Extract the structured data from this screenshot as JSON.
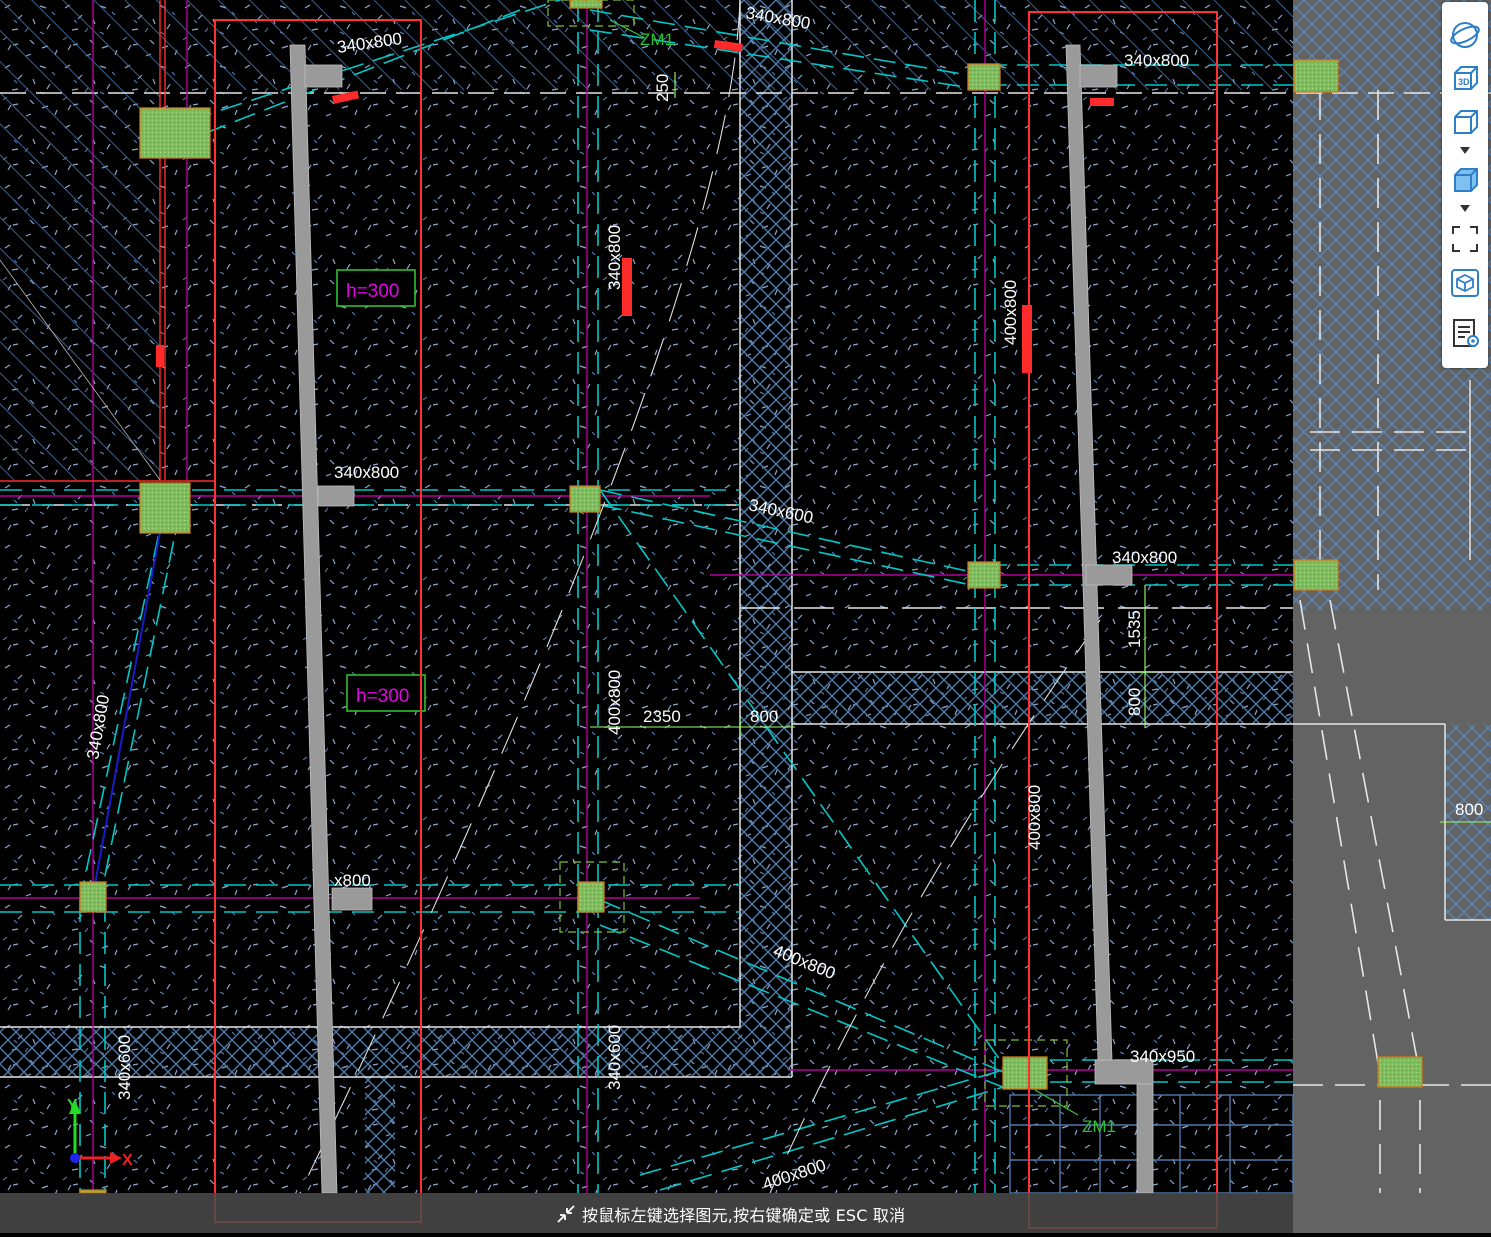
{
  "colors": {
    "background": "#000000",
    "cyan": "#00c8c8",
    "magenta": "#b4009a",
    "red": "#ff2a2a",
    "green_fill": "#7fbf5a",
    "hatch": "#4a78b0",
    "member": "#9a9a9a",
    "selection": "#ff3030",
    "toolbar_icon": "#2d7fc8"
  },
  "canvas": {
    "labels": {
      "beam_340x800_top_left": "340x800",
      "beam_340x800_top_right": "340x800",
      "beam_340x800_mid_left": "340x800",
      "beam_340x800_mid_right": "340x800",
      "beam_340x800_low_left": "x800",
      "beam_340x800_vertical_center": "340x800",
      "beam_340x800_top_center": "340x800",
      "beam_340x800_diag_left": "340x800",
      "beam_340x800_diag_center": "340x600",
      "beam_400x800_center_vertical": "400x800",
      "beam_400x800_right_vertical": "400x800",
      "beam_400x800_right_vertical_low": "400x800",
      "beam_400x800_diag": "400x800",
      "beam_400x800_bottom": "400x800",
      "beam_340x950": "340x950",
      "beam_340x600_left_bottom": "340x600",
      "beam_340x600_center_bottom": "340x600",
      "slab_h_300_a": "h=300",
      "slab_h_300_b": "h=300",
      "door_zm1_top": "ZM1",
      "door_zm1_bottom": "ZM1",
      "dim_250": "250",
      "dim_2350": "2350",
      "dim_800_a": "800",
      "dim_800_b": "800",
      "dim_800_c": "800",
      "dim_1535": "1535"
    },
    "axis": {
      "x": "X",
      "y": "Y"
    }
  },
  "toolbar": {
    "items": [
      {
        "icon": "orbit-icon"
      },
      {
        "icon": "3d-view-icon"
      },
      {
        "icon": "cube-outline-icon"
      },
      {
        "icon": "cube-filled-icon"
      },
      {
        "icon": "fit-view-icon"
      },
      {
        "icon": "component-view-icon"
      },
      {
        "icon": "display-settings-icon"
      }
    ]
  },
  "statusbar": {
    "prompt": "按鼠标左键选择图元,按右键确定或 ESC 取消"
  }
}
